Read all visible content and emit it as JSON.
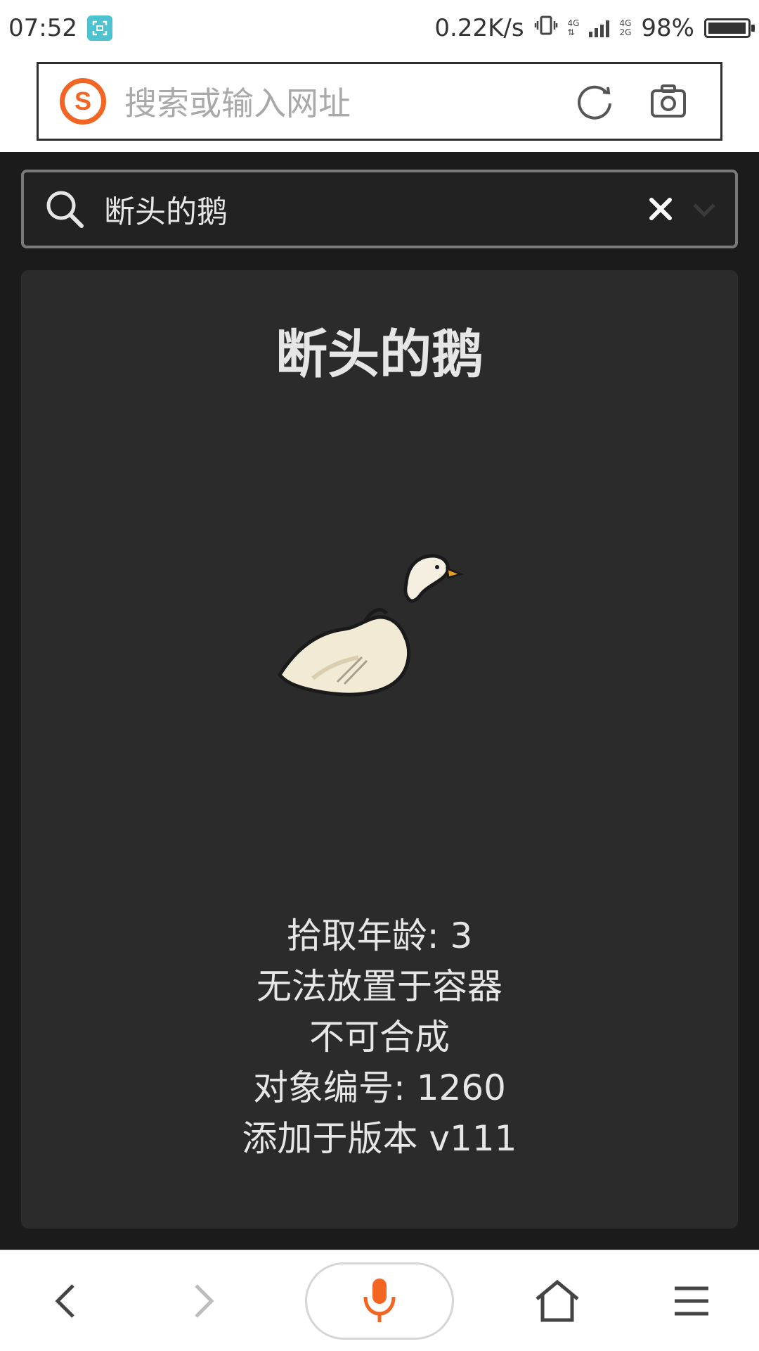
{
  "status_bar": {
    "time": "07:52",
    "net_speed": "0.22K/s",
    "net_type_top": "4G",
    "net_type_bottom": "4G",
    "net_type_bottom2": "2G",
    "battery": "98%",
    "battery_level": 0.98
  },
  "browser": {
    "address_placeholder": "搜索或输入网址",
    "logo_letter": "S",
    "accent_color": "#f26522"
  },
  "search": {
    "query": "断头的鹅"
  },
  "item": {
    "title": "断头的鹅",
    "image_icon": "decapitated-goose",
    "properties": [
      "拾取年龄: 3",
      "无法放置于容器",
      "不可合成",
      "对象编号: 1260",
      "添加于版本 v111"
    ]
  },
  "bottom_nav": {
    "icons": [
      "back-icon",
      "forward-icon",
      "mic-icon",
      "home-icon",
      "menu-icon"
    ]
  }
}
